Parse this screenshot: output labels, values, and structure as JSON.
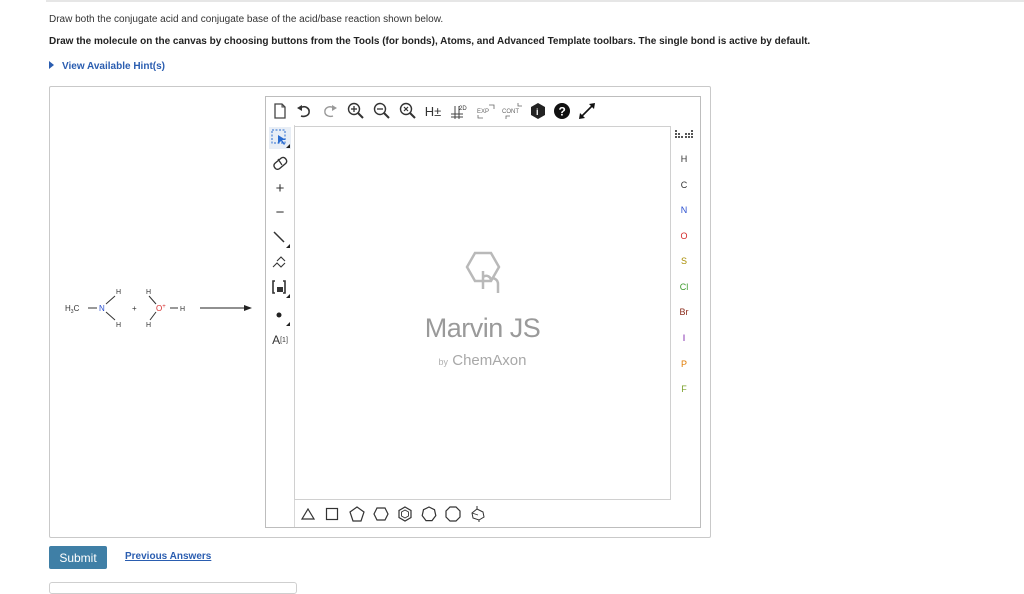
{
  "question": {
    "line1": "Draw both the conjugate acid and conjugate base of the acid/base reaction shown below.",
    "line2": "Draw the molecule on the canvas by choosing buttons from the Tools (for bonds), Atoms, and Advanced Template toolbars. The single bond is active by default.",
    "hint_label": "View Available Hint(s)"
  },
  "reaction": {
    "reactant1": {
      "methyl": "H",
      "methyl_sub": "3",
      "methyl_c": "C",
      "nitrogen": "N",
      "h_top": "H",
      "h_bottom": "H"
    },
    "plus": "+",
    "reactant2": {
      "oxygen": "O",
      "charge": "+",
      "h_top": "H",
      "h_right": "H",
      "h_bottom": "H"
    }
  },
  "editor": {
    "top_toolbar": [
      {
        "name": "new-document-icon"
      },
      {
        "name": "undo-icon"
      },
      {
        "name": "redo-icon"
      },
      {
        "name": "zoom-in-icon"
      },
      {
        "name": "zoom-out-icon"
      },
      {
        "name": "clean-icon"
      },
      {
        "name": "hydrogens-icon",
        "label": "H±"
      },
      {
        "name": "clean-2d-icon",
        "label": "2D"
      },
      {
        "name": "expand-icon",
        "label": "EXP"
      },
      {
        "name": "contract-icon",
        "label": "CONT"
      },
      {
        "name": "info-icon"
      },
      {
        "name": "help-icon"
      },
      {
        "name": "fullscreen-icon"
      }
    ],
    "left_toolbar": [
      {
        "name": "select-icon"
      },
      {
        "name": "erase-icon"
      },
      {
        "name": "increase-charge-icon",
        "label": "+"
      },
      {
        "name": "decrease-charge-icon",
        "label": "−"
      },
      {
        "name": "single-bond-icon"
      },
      {
        "name": "chain-icon"
      },
      {
        "name": "bracket-icon"
      },
      {
        "name": "radical-icon"
      },
      {
        "name": "atom-map-icon",
        "label": "A",
        "sup": "[1]"
      }
    ],
    "atoms": [
      "H",
      "C",
      "N",
      "O",
      "S",
      "Cl",
      "Br",
      "I",
      "P",
      "F"
    ],
    "atom_colors": {
      "H": "#333333",
      "C": "#333333",
      "N": "#2a4fcf",
      "O": "#d42a2a",
      "S": "#a88c00",
      "Cl": "#3a9a2a",
      "Br": "#8a2a1a",
      "I": "#7a1aa8",
      "P": "#e07a00",
      "F": "#7aa02a"
    },
    "periodic_table_icon": "periodic-table-icon",
    "bottom_templates": [
      {
        "name": "triangle-template-icon"
      },
      {
        "name": "square-template-icon"
      },
      {
        "name": "pentagon-template-icon"
      },
      {
        "name": "hexagon-template-icon"
      },
      {
        "name": "benzene-template-icon"
      },
      {
        "name": "heptagon-template-icon"
      },
      {
        "name": "octagon-template-icon"
      },
      {
        "name": "cyclohexane-chair-template-icon"
      }
    ],
    "watermark": {
      "title": "Marvin JS",
      "by": "by",
      "brand": "ChemAxon"
    }
  },
  "actions": {
    "submit": "Submit",
    "previous": "Previous Answers"
  }
}
